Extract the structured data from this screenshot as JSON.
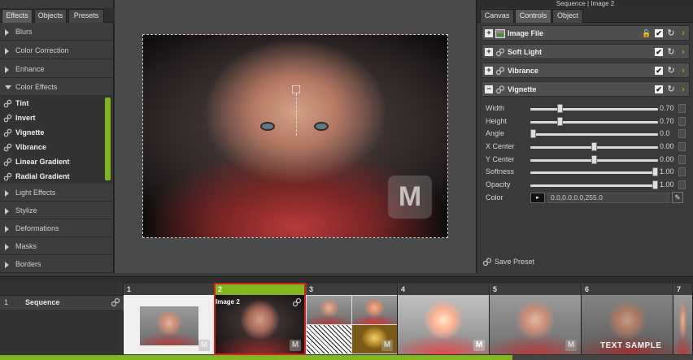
{
  "left_panel": {
    "tabs": [
      "Effects",
      "Objects",
      "Presets"
    ],
    "categories_top": [
      "Blurs",
      "Color Correction",
      "Enhance",
      "Color Effects"
    ],
    "effects": [
      "Tint",
      "Invert",
      "Vignette",
      "Vibrance",
      "Linear Gradient",
      "Radial Gradient"
    ],
    "categories_bottom": [
      "Light Effects",
      "Stylize",
      "Deformations",
      "Masks",
      "Borders"
    ]
  },
  "canvas": {
    "watermark": "M"
  },
  "right_panel": {
    "title": "Sequence | Image 2",
    "tabs": [
      "Canvas",
      "Controls",
      "Object"
    ],
    "layers": [
      {
        "label": "Image File",
        "expanded": false
      },
      {
        "label": "Soft Light",
        "expanded": false
      },
      {
        "label": "Vibrance",
        "expanded": false
      },
      {
        "label": "Vignette",
        "expanded": true
      }
    ],
    "params": [
      {
        "label": "Width",
        "value": "0.70",
        "level": 0.22
      },
      {
        "label": "Height",
        "value": "0.70",
        "level": 0.22
      },
      {
        "label": "Angle",
        "value": "0.0",
        "level": 0.0
      },
      {
        "label": "X Center",
        "value": "0.00",
        "level": 0.5
      },
      {
        "label": "Y Center",
        "value": "0.00",
        "level": 0.5
      },
      {
        "label": "Softness",
        "value": "1.00",
        "level": 1.0
      },
      {
        "label": "Opacity",
        "value": "1.00",
        "level": 1.0
      }
    ],
    "color_label": "Color",
    "color_value": "0.0,0.0,0.0,255.0",
    "save_preset": "Save Preset"
  },
  "sequence": {
    "row_number": "1",
    "name": "Sequence",
    "frames": [
      "1",
      "2",
      "3",
      "4",
      "5",
      "6",
      "7"
    ],
    "selected_frame": "2",
    "frame2_label": "Image 2",
    "frame_watermark": "M",
    "text_sample": "TEXT SAMPLE",
    "timeline_progress": 0.74
  },
  "colors": {
    "accent_green": "#80b61e",
    "selection_red": "#d32020"
  }
}
